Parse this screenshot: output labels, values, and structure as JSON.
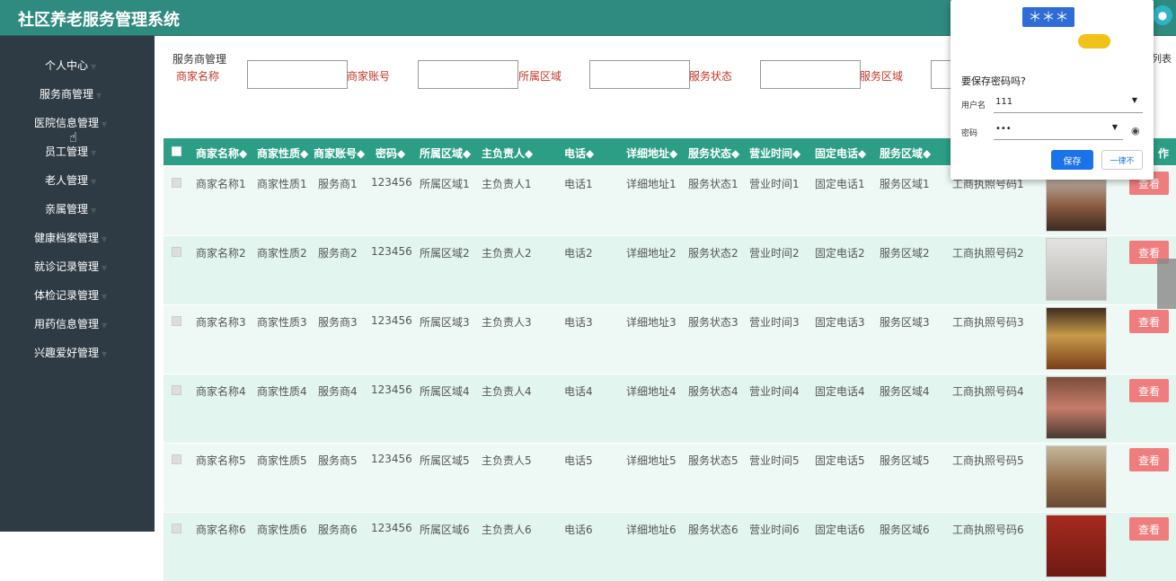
{
  "app": {
    "title": "社区养老服务管理系统"
  },
  "sidebar": {
    "items": [
      {
        "label": "个人中心"
      },
      {
        "label": "服务商管理"
      },
      {
        "label": "医院信息管理"
      },
      {
        "label": "员工管理"
      },
      {
        "label": "老人管理"
      },
      {
        "label": "亲属管理"
      },
      {
        "label": "健康档案管理"
      },
      {
        "label": "就诊记录管理"
      },
      {
        "label": "体检记录管理"
      },
      {
        "label": "用药信息管理"
      },
      {
        "label": "兴趣爱好管理"
      }
    ]
  },
  "page": {
    "title": "服务商管理",
    "right_cut_text": "列表"
  },
  "filters": {
    "labels": [
      "商家名称",
      "商家账号",
      "所属区域",
      "服务状态",
      "服务区域"
    ]
  },
  "table": {
    "headers": [
      "商家名称◆",
      "商家性质◆",
      "商家账号◆",
      "密码◆",
      "所属区域◆",
      "主负责人◆",
      "电话◆",
      "详细地址◆",
      "服务状态◆",
      "营业时间◆",
      "固定电话◆",
      "服务区域◆",
      "作"
    ],
    "rows": [
      {
        "name": "商家名称1",
        "nature": "商家性质1",
        "account": "服务商1",
        "password": "123456",
        "region": "所属区域1",
        "leader": "主负责人1",
        "phone": "电话1",
        "address": "详细地址1",
        "status": "服务状态1",
        "hours": "营业时间1",
        "tel": "固定电话1",
        "area": "服务区域1",
        "license": "工商执照号码1",
        "action": "查看"
      },
      {
        "name": "商家名称2",
        "nature": "商家性质2",
        "account": "服务商2",
        "password": "123456",
        "region": "所属区域2",
        "leader": "主负责人2",
        "phone": "电话2",
        "address": "详细地址2",
        "status": "服务状态2",
        "hours": "营业时间2",
        "tel": "固定电话2",
        "area": "服务区域2",
        "license": "工商执照号码2",
        "action": "查看"
      },
      {
        "name": "商家名称3",
        "nature": "商家性质3",
        "account": "服务商3",
        "password": "123456",
        "region": "所属区域3",
        "leader": "主负责人3",
        "phone": "电话3",
        "address": "详细地址3",
        "status": "服务状态3",
        "hours": "营业时间3",
        "tel": "固定电话3",
        "area": "服务区域3",
        "license": "工商执照号码3",
        "action": "查看"
      },
      {
        "name": "商家名称4",
        "nature": "商家性质4",
        "account": "服务商4",
        "password": "123456",
        "region": "所属区域4",
        "leader": "主负责人4",
        "phone": "电话4",
        "address": "详细地址4",
        "status": "服务状态4",
        "hours": "营业时间4",
        "tel": "固定电话4",
        "area": "服务区域4",
        "license": "工商执照号码4",
        "action": "查看"
      },
      {
        "name": "商家名称5",
        "nature": "商家性质5",
        "account": "服务商5",
        "password": "123456",
        "region": "所属区域5",
        "leader": "主负责人5",
        "phone": "电话5",
        "address": "详细地址5",
        "status": "服务状态5",
        "hours": "营业时间5",
        "tel": "固定电话5",
        "area": "服务区域5",
        "license": "工商执照号码5",
        "action": "查看"
      },
      {
        "name": "商家名称6",
        "nature": "商家性质6",
        "account": "服务商6",
        "password": "123456",
        "region": "所属区域6",
        "leader": "主负责人6",
        "phone": "电话6",
        "address": "详细地址6",
        "status": "服务状态6",
        "hours": "营业时间6",
        "tel": "固定电话6",
        "area": "服务区域6",
        "license": "工商执照号码6",
        "action": "查看"
      }
    ]
  },
  "password_popup": {
    "mask": "＊＊＊",
    "question": "要保存密码吗?",
    "username_label": "用户名",
    "username_value": "111",
    "password_label": "密码",
    "password_value": "•••",
    "save_label": "保存",
    "never_label": "一律不"
  },
  "colors": {
    "header": "#2f8a7f",
    "sidebar": "#2f3b44",
    "table_head": "#2d9e86",
    "view_button": "#f07d7d",
    "filter_label": "#c0392b"
  }
}
